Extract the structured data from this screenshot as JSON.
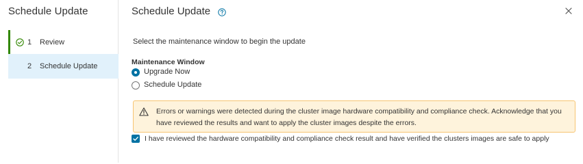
{
  "nav": {
    "title": "Schedule Update",
    "steps": [
      {
        "number": "1",
        "label": "Review",
        "status": "completed"
      },
      {
        "number": "2",
        "label": "Schedule Update",
        "status": "active"
      }
    ]
  },
  "header": {
    "title": "Schedule Update",
    "help_icon": "help-circle-icon",
    "close_icon": "close-icon"
  },
  "content": {
    "prompt": "Select the maintenance window to begin the update",
    "maintenance_window": {
      "label": "Maintenance Window",
      "options": [
        {
          "label": "Upgrade Now",
          "selected": true
        },
        {
          "label": "Schedule Update",
          "selected": false
        }
      ]
    },
    "warning": {
      "icon": "warning-triangle-icon",
      "text": "Errors or warnings were detected during the cluster image hardware compatibility and compliance check. Acknowledge that you have reviewed the results and want to apply the cluster images despite the errors."
    },
    "acknowledge": {
      "checked": true,
      "label": "I have reviewed the hardware compatibility and compliance check result and have verified the clusters images are safe to apply"
    }
  },
  "colors": {
    "accent": "#0072a3",
    "completed": "#318700",
    "active_step_bg": "#e1f1fb",
    "warning_bg": "#fef3dc",
    "warning_border": "#f7c471"
  }
}
